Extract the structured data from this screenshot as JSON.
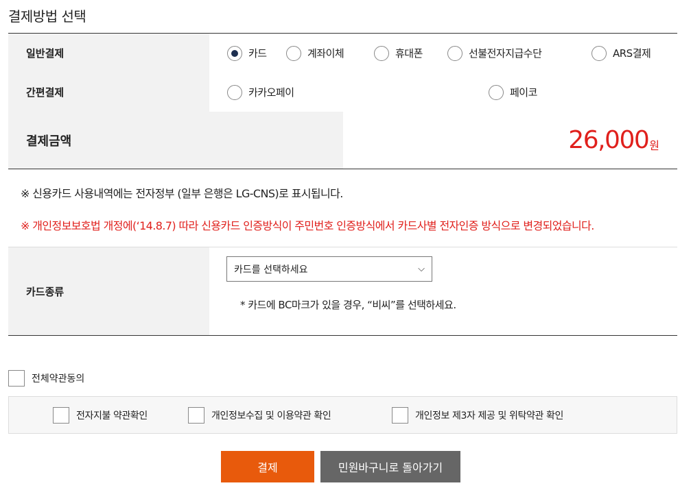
{
  "page": {
    "title": "결제방법 선택"
  },
  "general_payment": {
    "label": "일반결제",
    "options": [
      {
        "label": "카드",
        "selected": true
      },
      {
        "label": "계좌이체",
        "selected": false
      },
      {
        "label": "휴대폰",
        "selected": false
      },
      {
        "label": "선불전자지급수단",
        "selected": false
      },
      {
        "label": "ARS결제",
        "selected": false
      }
    ]
  },
  "easy_payment": {
    "label": "간편결제",
    "options": [
      {
        "label": "카카오페이",
        "selected": false
      },
      {
        "label": "페이코",
        "selected": false
      }
    ]
  },
  "amount": {
    "label": "결제금액",
    "value": "26,000",
    "unit": "원"
  },
  "notices": {
    "line1": "※ 신용카드 사용내역에는 전자정부 (일부 은행은 LG-CNS)로 표시됩니다.",
    "line2": "※ 개인정보보호법 개정에(‘14.8.7) 따라 신용카드 인증방식이 주민번호 인증방식에서 카드사별 전자인증 방식으로 변경되었습니다."
  },
  "card_type": {
    "label": "카드종류",
    "select_value": "카드를 선택하세요",
    "hint": "* 카드에 BC마크가 있을 경우, “비씨”를 선택하세요."
  },
  "agreements": {
    "all_label": "전체약관동의",
    "items": [
      {
        "label": "전자지불 약관확인",
        "checked": false
      },
      {
        "label": "개인정보수집 및 이용약관 확인",
        "checked": false
      },
      {
        "label": "개인정보 제3자 제공 및 위탁약관 확인",
        "checked": false
      }
    ]
  },
  "buttons": {
    "pay": "결제",
    "back": "민원바구니로 돌아가기"
  },
  "colors": {
    "accent_red": "#e0201c",
    "pay_button": "#e85a0c",
    "back_button": "#666666",
    "radio_selected": "#1d2e4f"
  }
}
